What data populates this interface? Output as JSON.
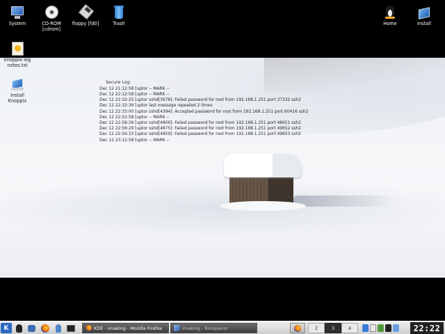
{
  "desktop": {
    "icons": [
      {
        "label": "System"
      },
      {
        "label": "CD-ROM\n[cdrom]"
      },
      {
        "label": "floppy [fd0]"
      },
      {
        "label": "Trash"
      },
      {
        "label": "Home"
      },
      {
        "label": "Install"
      },
      {
        "label": "knoppix log\nnotes.txt"
      },
      {
        "label": "Install Knoppix"
      }
    ]
  },
  "log": {
    "title": "Secure Log:",
    "lines": [
      "Dec 12 21:12:58 [uptor -- MARK --",
      "Dec 12 22:12:58 [uptor -- MARK --",
      "Dec 12 22:32:25 [uptor sshd[3978]: Failed password for root from 192.168.1.251 port 37332 ssh2",
      "Dec 12 22:32:39 [uptor last message repeated 2 times",
      "Dec 12 22:33:00 [uptor sshd[4394]: Accepted password for root from 192.168.1.251 port 60416 ssh2",
      "Dec 12 22:52:58 [uptor -- MARK --",
      "Dec 12 22:56:26 [uptor sshd[4806]: Failed password for root from 192.168.1.251 port 48651 ssh2",
      "Dec 12 22:56:29 [uptor sshd[4875]: Failed password for root from 192.168.1.251 port 49652 ssh2",
      "Dec 12 22:56:33 [uptor sshd[4859]: Failed password for root from 192.168.1.251 port 49653 ssh2",
      "Dec 12 23:12:58 [uptor -- MARK --"
    ]
  },
  "taskbar": {
    "k_menu": "K",
    "tasks": [
      {
        "label": "KDE - imaking - Mozilla Firefox"
      },
      {
        "label": "imaking - Konqueror"
      }
    ],
    "pager": [
      "2",
      "3",
      "4"
    ],
    "clock": "22:22"
  },
  "colors": {
    "taskbar_bg": "#d9d9d9",
    "kmenu": "#2b67c0"
  }
}
